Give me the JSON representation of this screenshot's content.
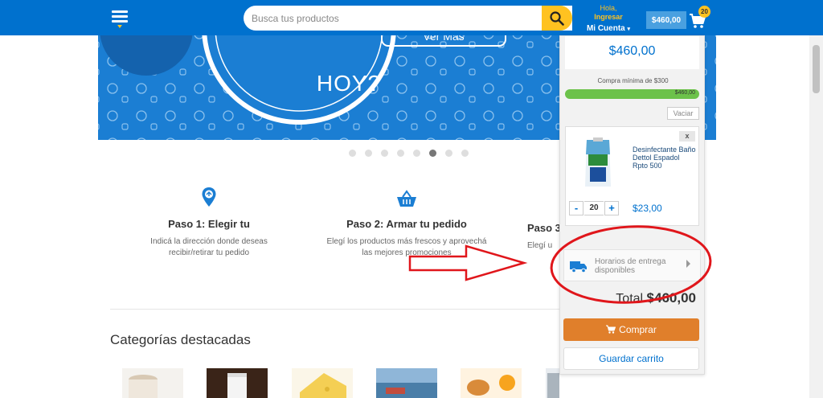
{
  "header": {
    "search_placeholder": "Busca tus productos",
    "account_hola": "Hola,",
    "account_ingresar": "Ingresar",
    "account_mi_cuenta": "Mi Cuenta",
    "cart_amount": "$460,00",
    "cart_count": "20"
  },
  "banner": {
    "headline": "HOY?",
    "button_label": "Ver Más"
  },
  "carousel": {
    "total": 8,
    "active": 6
  },
  "steps": [
    {
      "title": "Paso 1: Elegir tu",
      "description_line1": "Indicá la dirección donde deseas",
      "description_line2": "recibir/retirar tu pedido"
    },
    {
      "title": "Paso 2: Armar tu pedido",
      "description_line1": "Elegí los productos más frescos y aprovechá",
      "description_line2": "las mejores promociones"
    },
    {
      "title": "Paso 3",
      "description_line1": "Elegí u",
      "description_line2": ""
    }
  ],
  "categories": {
    "title": "Categorías destacadas"
  },
  "cart_panel": {
    "subtotal": "$460,00",
    "min_purchase": "Compra mínima de $300",
    "progress_label": "$460,00",
    "progress": 1.0,
    "clear_label": "Vaciar",
    "item": {
      "remove_label": "x",
      "name": "Desinfectante Baño Dettol Espadol Rpto 500",
      "qty_minus": "-",
      "qty": "20",
      "qty_plus": "+",
      "price": "$23,00"
    },
    "delivery_label_line1": "Horarios de entrega",
    "delivery_label_line2": "disponibles",
    "total_label": "Total",
    "total_value": "$460,00",
    "buy_label": "Comprar",
    "save_label": "Guardar carrito"
  },
  "colors": {
    "brand_blue": "#0071ce",
    "accent_yellow": "#ffc220",
    "buy_orange": "#e07f2b",
    "progress_green": "#6cc24a",
    "annotation_red": "#e0161b"
  }
}
